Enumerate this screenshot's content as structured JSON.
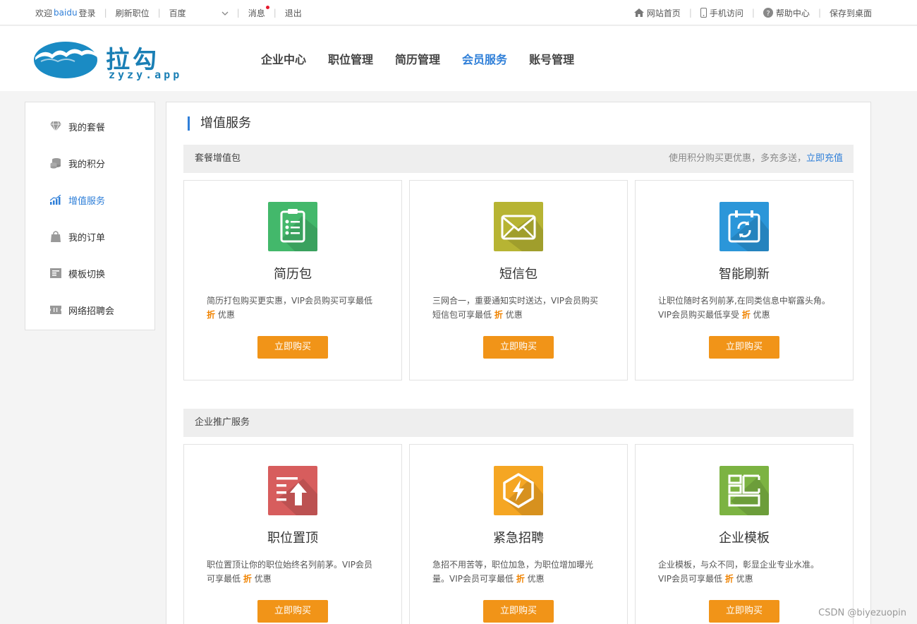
{
  "topbar": {
    "welcome": "欢迎",
    "username": "baidu",
    "login": "登录",
    "refresh_jobs": "刷新职位",
    "search_engine": "百度",
    "messages": "消息",
    "logout": "退出",
    "home": "网站首页",
    "mobile": "手机访问",
    "help": "帮助中心",
    "save_desktop": "保存到桌面"
  },
  "logo": {
    "text": "拉勾",
    "sub": "zyzy.app"
  },
  "nav": {
    "items": [
      {
        "label": "企业中心"
      },
      {
        "label": "职位管理"
      },
      {
        "label": "简历管理"
      },
      {
        "label": "会员服务",
        "active": true
      },
      {
        "label": "账号管理"
      }
    ]
  },
  "sidebar": {
    "items": [
      {
        "label": "我的套餐",
        "icon": "diamond-icon"
      },
      {
        "label": "我的积分",
        "icon": "coins-icon"
      },
      {
        "label": "增值服务",
        "icon": "chart-icon",
        "active": true
      },
      {
        "label": "我的订单",
        "icon": "bag-icon"
      },
      {
        "label": "模板切换",
        "icon": "template-icon"
      },
      {
        "label": "网络招聘会",
        "icon": "ticket-icon"
      }
    ]
  },
  "main": {
    "title": "增值服务",
    "section1": {
      "title": "套餐增值包",
      "note": "使用积分购买更优惠，多充多送，",
      "note_link": "立即充值"
    },
    "section2": {
      "title": "企业推广服务"
    },
    "cards": [
      {
        "title": "简历包",
        "icon": "clipboard-icon",
        "color": "#43b86b",
        "desc_a": "简历打包购买更实惠，VIP会员购买可享最低",
        "desc_b": "",
        "disc": "折",
        "desc_c": "优惠",
        "button": "立即购买"
      },
      {
        "title": "短信包",
        "icon": "envelope-icon",
        "color": "#b7b433",
        "desc_a": "三网合一，重要通知实时送达，VIP会员购买",
        "desc_b": "短信包可享最低",
        "disc": "折",
        "desc_c": "优惠",
        "button": "立即购买"
      },
      {
        "title": "智能刷新",
        "icon": "refresh-calendar-icon",
        "color": "#2b96d9",
        "desc_a": "让职位随时名列前茅,在同类信息中崭露头角。",
        "desc_b": "VIP会员购买最低享受",
        "disc": "折",
        "desc_c": "优惠",
        "button": "立即购买"
      },
      {
        "title": "职位置顶",
        "icon": "top-arrow-icon",
        "color": "#d75d5d",
        "desc_a": "职位置顶让你的职位始终名列前茅。VIP会员",
        "desc_b": "可享最低",
        "disc": "折",
        "desc_c": "优惠",
        "button": "立即购买"
      },
      {
        "title": "紧急招聘",
        "icon": "lightning-icon",
        "color": "#f5a623",
        "desc_a": "急招不用苦等，职位加急，为职位增加曝光",
        "desc_b": "量。VIP会员可享最低",
        "disc": "折",
        "desc_c": "优惠",
        "button": "立即购买"
      },
      {
        "title": "企业模板",
        "icon": "template-grid-icon",
        "color": "#7cb342",
        "desc_a": "企业模板，与众不同，彰显企业专业水准。",
        "desc_b": "VIP会员可享最低",
        "disc": "折",
        "desc_c": "优惠",
        "button": "立即购买"
      }
    ]
  },
  "watermark": "CSDN @biyezuopin"
}
